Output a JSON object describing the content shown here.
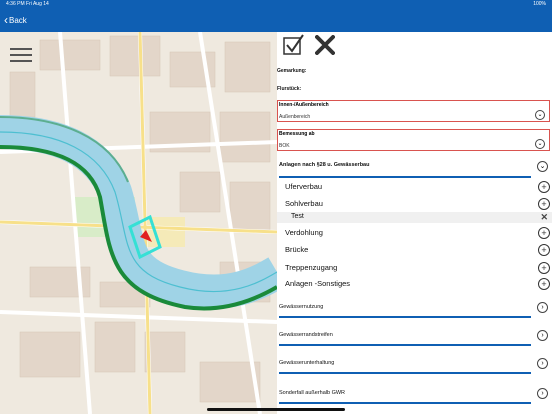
{
  "status_bar": {
    "time": "4:36 PM  Fri Aug 14",
    "battery": "100%"
  },
  "nav": {
    "back_label": "Back"
  },
  "form": {
    "gemarkung_label": "Gemarkung:",
    "flurstueck_label": "Flurstück:",
    "innen_label": "Innen-/Außenbereich",
    "innen_value": "Außenbereich",
    "bemessung_label": "Bemessung ab",
    "bemessung_value": "BOK"
  },
  "section_anlagen": {
    "title": "Anlagen nach §28 u. Gewässerbau",
    "items": [
      {
        "label": "Uferverbau"
      },
      {
        "label": "Sohlverbau"
      },
      {
        "label": "Verdohlung"
      },
      {
        "label": "Brücke"
      },
      {
        "label": "Treppenzugang"
      },
      {
        "label": "Anlagen  -Sonstiges"
      }
    ],
    "sub_entry": "Test"
  },
  "categories": [
    {
      "label": "Gewässernutzung"
    },
    {
      "label": "Gewässerrandstreifen"
    },
    {
      "label": "Gewässerunterhaltung"
    },
    {
      "label": "Sonderfall außerhalb GWR"
    }
  ],
  "colors": {
    "brand_blue": "#0f5fb3",
    "required_red": "#d9534f",
    "river": "#9fd3e6",
    "river_outline": "#1a8a3a"
  }
}
